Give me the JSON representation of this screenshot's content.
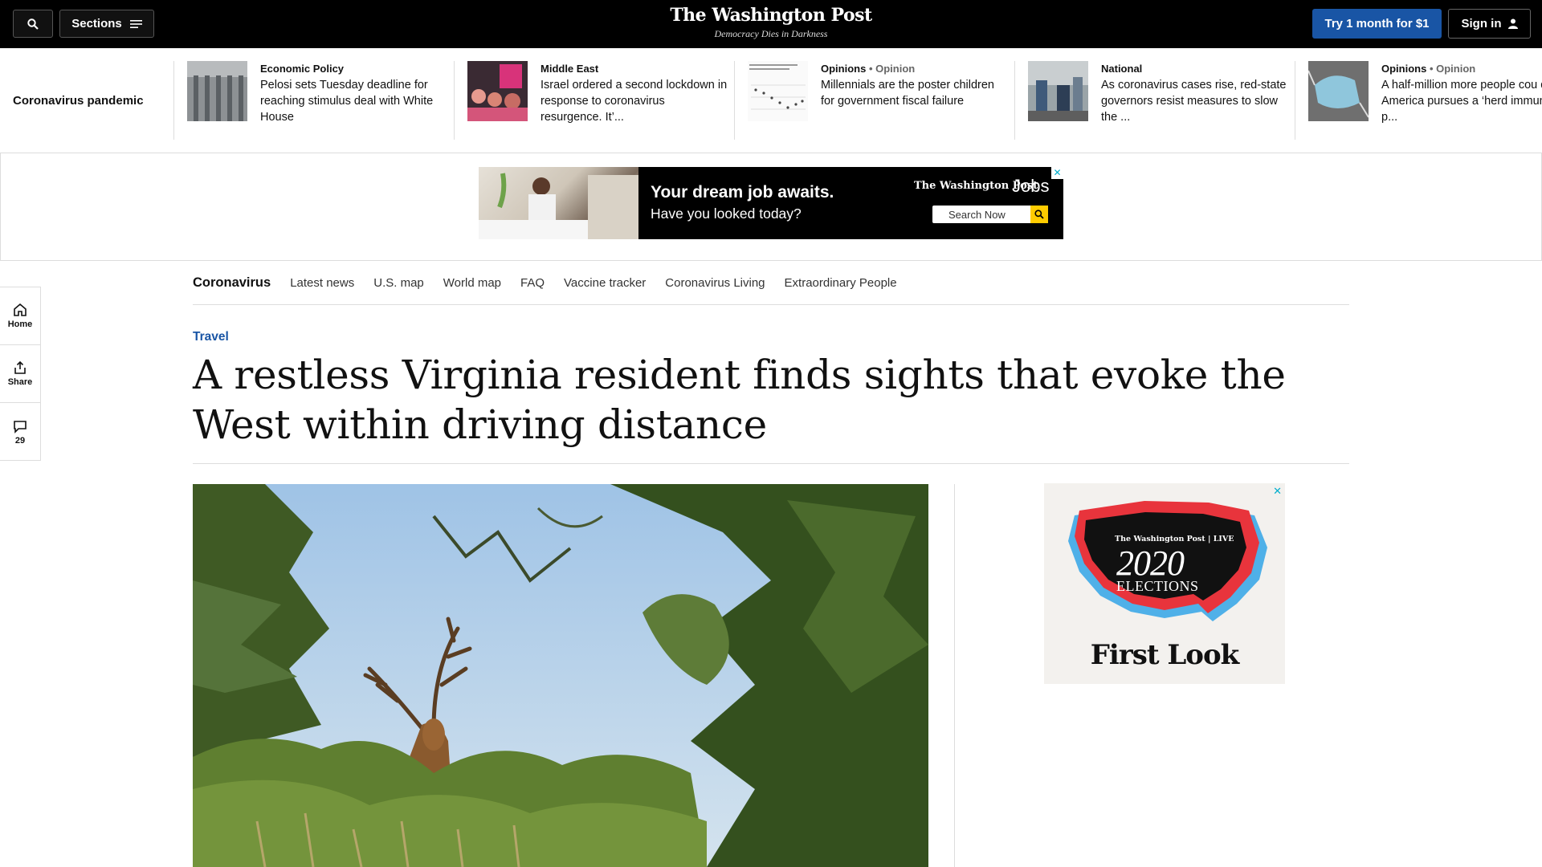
{
  "header": {
    "sections_label": "Sections",
    "logo": "The Washington Post",
    "tagline": "Democracy Dies in Darkness",
    "try_label": "Try 1 month for $1",
    "signin_label": "Sign in",
    "colors": {
      "bar": "#000000",
      "accent": "#1955a5"
    }
  },
  "strip": {
    "label": "Coronavirus pandemic",
    "items": [
      {
        "kicker": "Economic Policy",
        "opinion": "",
        "text": "Pelosi sets Tuesday deadline for reaching stimulus deal with White House"
      },
      {
        "kicker": "Middle East",
        "opinion": "",
        "text": "Israel ordered a second lockdown in response to coronavirus resurgence. It’..."
      },
      {
        "kicker": "Opinions",
        "opinion": "• Opinion",
        "text": "Millennials are the poster children for government fiscal failure"
      },
      {
        "kicker": "National",
        "opinion": "",
        "text": "As coronavirus cases rise, red-state governors resist measures to slow the ..."
      },
      {
        "kicker": "Opinions",
        "opinion": "• Opinion",
        "text": "A half-million more people cou die if America pursues a ‘herd immunity’ p..."
      }
    ]
  },
  "ad_jobs": {
    "headline": "Your dream job awaits.",
    "subhead": "Have you looked today?",
    "brand": "The Washington Post",
    "jobs_word": "Jobs",
    "search_label": "Search Now"
  },
  "section_nav": {
    "title": "Coronavirus",
    "links": [
      "Latest news",
      "U.S. map",
      "World map",
      "FAQ",
      "Vaccine tracker",
      "Coronavirus Living",
      "Extraordinary People"
    ]
  },
  "rail": {
    "home": "Home",
    "share": "Share",
    "comments": "29"
  },
  "article": {
    "kicker": "Travel",
    "headline": "A restless Virginia resident finds sights that evoke the West within driving distance"
  },
  "ad_elections": {
    "brand": "The Washington Post | LIVE",
    "year": "2020",
    "label": "ELECTIONS",
    "first_look": "First Look"
  }
}
